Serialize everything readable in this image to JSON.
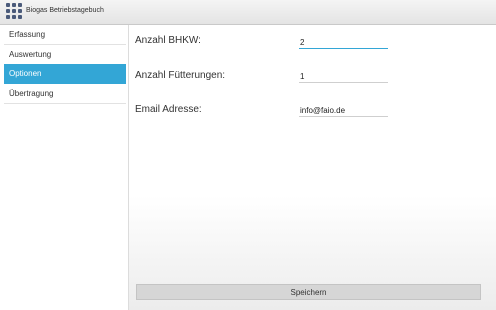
{
  "app": {
    "title": "Biogas Betriebstagebuch",
    "icon": "app-grid-icon"
  },
  "sidebar": {
    "items": [
      {
        "label": "Erfassung",
        "selected": false
      },
      {
        "label": "Auswertung",
        "selected": false
      },
      {
        "label": "Optionen",
        "selected": true
      },
      {
        "label": "Übertragung",
        "selected": false
      }
    ]
  },
  "form": {
    "fields": [
      {
        "label": "Anzahl BHKW:",
        "value": "2"
      },
      {
        "label": "Anzahl Fütterungen:",
        "value": "1"
      },
      {
        "label": "Email Adresse:",
        "value": "info@faio.de"
      }
    ],
    "save_label": "Speichern"
  },
  "colors": {
    "accent": "#33a6d6"
  }
}
